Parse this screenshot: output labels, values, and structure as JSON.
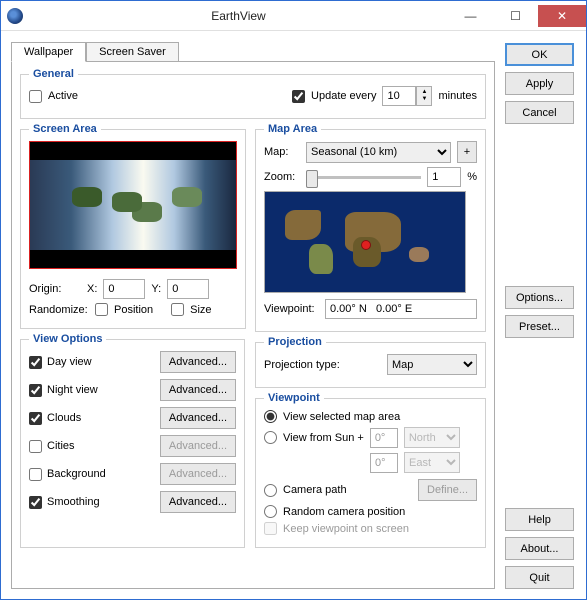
{
  "window": {
    "title": "EarthView"
  },
  "tabs": {
    "wallpaper": "Wallpaper",
    "screensaver": "Screen Saver"
  },
  "general": {
    "legend": "General",
    "active": "Active",
    "update_every": "Update every",
    "update_value": "10",
    "minutes": "minutes"
  },
  "screen_area": {
    "legend": "Screen Area",
    "origin": "Origin:",
    "x_label": "X:",
    "x_value": "0",
    "y_label": "Y:",
    "y_value": "0",
    "randomize": "Randomize:",
    "position": "Position",
    "size": "Size"
  },
  "view_options": {
    "legend": "View Options",
    "day_view": "Day view",
    "night_view": "Night view",
    "clouds": "Clouds",
    "cities": "Cities",
    "background": "Background",
    "smoothing": "Smoothing",
    "advanced": "Advanced..."
  },
  "map_area": {
    "legend": "Map Area",
    "map_label": "Map:",
    "map_value": "Seasonal (10 km)",
    "plus": "+",
    "zoom_label": "Zoom:",
    "zoom_value": "1",
    "zoom_unit": "%",
    "viewpoint": "Viewpoint:",
    "coords": "0.00° N   0.00° E"
  },
  "projection": {
    "legend": "Projection",
    "label": "Projection type:",
    "value": "Map"
  },
  "viewpoint": {
    "legend": "Viewpoint",
    "selected_map": "View selected map area",
    "from_sun": "View from Sun +",
    "lat_value": "0°",
    "lat_dir": "North",
    "lon_value": "0°",
    "lon_dir": "East",
    "camera_path": "Camera path",
    "define": "Define...",
    "random": "Random camera position",
    "keep": "Keep viewpoint on screen"
  },
  "sidebar": {
    "ok": "OK",
    "apply": "Apply",
    "cancel": "Cancel",
    "options": "Options...",
    "preset": "Preset...",
    "help": "Help",
    "about": "About...",
    "quit": "Quit"
  }
}
